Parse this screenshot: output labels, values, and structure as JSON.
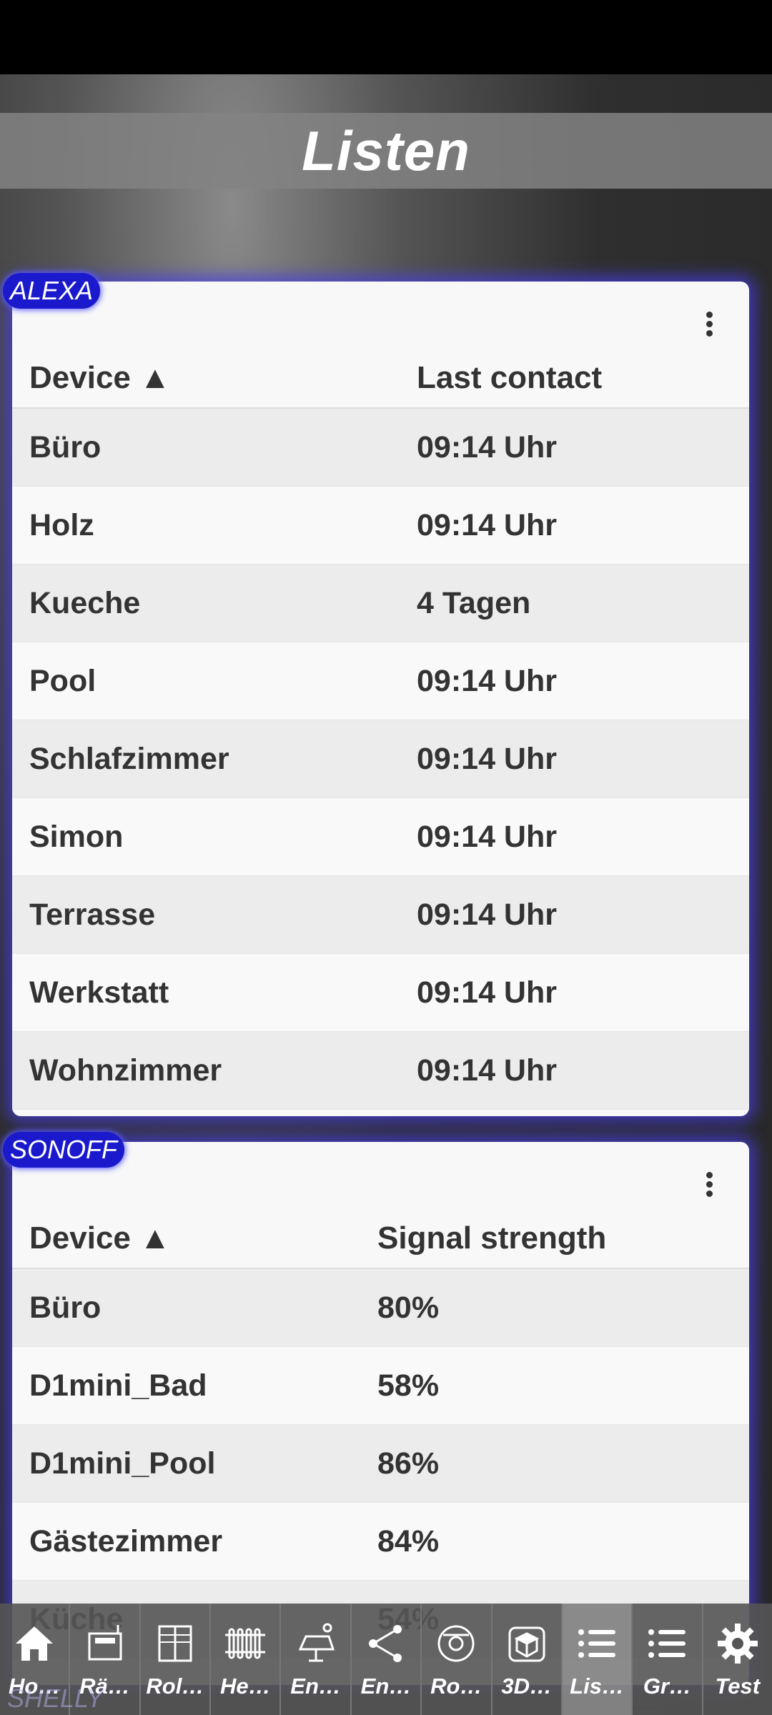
{
  "page": {
    "title": "Listen"
  },
  "colors": {
    "accent": "#1a1acc",
    "glow": "#463ce6",
    "nav_bg": "#555555"
  },
  "alexa": {
    "tag": "ALEXA",
    "headers": {
      "device": "Device ▲",
      "value": "Last contact"
    },
    "rows": [
      {
        "device": "Büro",
        "value": "09:14 Uhr"
      },
      {
        "device": "Holz",
        "value": "09:14 Uhr"
      },
      {
        "device": "Kueche",
        "value": "4 Tagen"
      },
      {
        "device": "Pool",
        "value": "09:14 Uhr"
      },
      {
        "device": "Schlafzimmer",
        "value": "09:14 Uhr"
      },
      {
        "device": "Simon",
        "value": "09:14 Uhr"
      },
      {
        "device": "Terrasse",
        "value": "09:14 Uhr"
      },
      {
        "device": "Werkstatt",
        "value": "09:14 Uhr"
      },
      {
        "device": "Wohnzimmer",
        "value": "09:14 Uhr"
      }
    ]
  },
  "sonoff": {
    "tag": "SONOFF",
    "headers": {
      "device": "Device ▲",
      "value": "Signal strength"
    },
    "rows": [
      {
        "device": "Büro",
        "value": "80%"
      },
      {
        "device": "D1mini_Bad",
        "value": "58%"
      },
      {
        "device": "D1mini_Pool",
        "value": "86%"
      },
      {
        "device": "Gästezimmer",
        "value": "84%"
      },
      {
        "device": "Küche",
        "value": "54%"
      }
    ]
  },
  "next_card_tag": "SHELLY",
  "nav": [
    {
      "label": "Ho…",
      "icon": "home-icon"
    },
    {
      "label": "Rä…",
      "icon": "rooms-icon"
    },
    {
      "label": "Rol…",
      "icon": "shutter-icon"
    },
    {
      "label": "He…",
      "icon": "radiator-icon"
    },
    {
      "label": "En…",
      "icon": "solar-icon"
    },
    {
      "label": "En…",
      "icon": "share-icon"
    },
    {
      "label": "Ro…",
      "icon": "robot-vacuum-icon"
    },
    {
      "label": "3D…",
      "icon": "cube-icon"
    },
    {
      "label": "Lis…",
      "icon": "list-icon",
      "active": true
    },
    {
      "label": "Gr…",
      "icon": "list-icon"
    },
    {
      "label": "Test",
      "icon": "gear-icon"
    }
  ]
}
